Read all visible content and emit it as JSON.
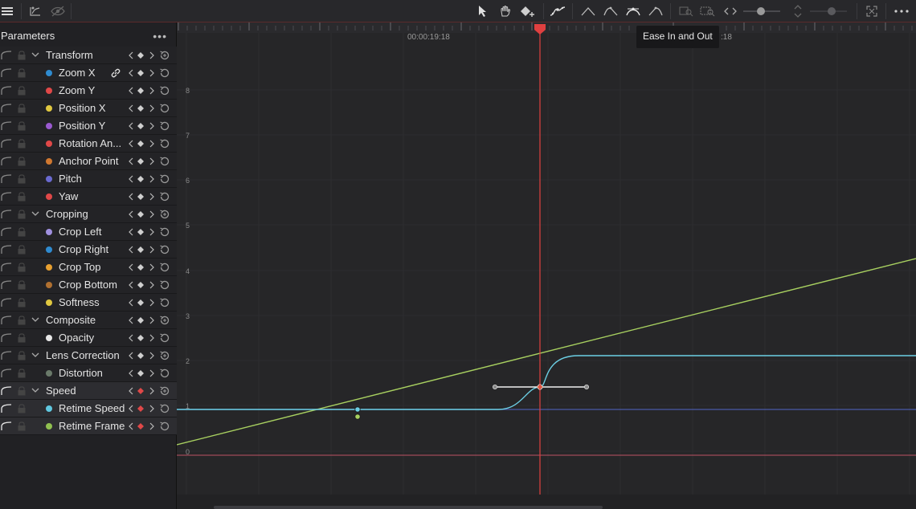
{
  "panel": {
    "title": "Parameters",
    "rows": [
      {
        "kind": "group",
        "label": "Transform",
        "keyframe": "none",
        "active": false
      },
      {
        "kind": "param",
        "label": "Zoom X",
        "dot": "#2f8bd0",
        "link": true,
        "keyframe": "none",
        "active": false
      },
      {
        "kind": "param",
        "label": "Zoom Y",
        "dot": "#e04848",
        "keyframe": "none",
        "active": false
      },
      {
        "kind": "param",
        "label": "Position X",
        "dot": "#e0c840",
        "keyframe": "none",
        "active": false
      },
      {
        "kind": "param",
        "label": "Position Y",
        "dot": "#9a5ad0",
        "keyframe": "none",
        "active": false
      },
      {
        "kind": "param",
        "label": "Rotation An...",
        "dot": "#e04848",
        "keyframe": "none",
        "active": false
      },
      {
        "kind": "param",
        "label": "Anchor Point",
        "dot": "#d07830",
        "keyframe": "none",
        "active": false
      },
      {
        "kind": "param",
        "label": "Pitch",
        "dot": "#6a6ad0",
        "keyframe": "none",
        "active": false
      },
      {
        "kind": "param",
        "label": "Yaw",
        "dot": "#e04848",
        "keyframe": "none",
        "active": false
      },
      {
        "kind": "group",
        "label": "Cropping",
        "keyframe": "none",
        "active": false
      },
      {
        "kind": "param",
        "label": "Crop Left",
        "dot": "#a090e0",
        "keyframe": "none",
        "active": false
      },
      {
        "kind": "param",
        "label": "Crop Right",
        "dot": "#2f8bd0",
        "keyframe": "none",
        "active": false
      },
      {
        "kind": "param",
        "label": "Crop Top",
        "dot": "#e8a030",
        "keyframe": "none",
        "active": false
      },
      {
        "kind": "param",
        "label": "Crop Bottom",
        "dot": "#b07030",
        "keyframe": "none",
        "active": false
      },
      {
        "kind": "param",
        "label": "Softness",
        "dot": "#e0c840",
        "keyframe": "none",
        "active": false
      },
      {
        "kind": "group",
        "label": "Composite",
        "keyframe": "none",
        "active": false
      },
      {
        "kind": "param",
        "label": "Opacity",
        "dot": "#e8e8e8",
        "keyframe": "none",
        "active": false
      },
      {
        "kind": "group",
        "label": "Lens Correction",
        "keyframe": "none",
        "active": false
      },
      {
        "kind": "param",
        "label": "Distortion",
        "dot": "#6a7a6a",
        "keyframe": "none",
        "active": false
      },
      {
        "kind": "group",
        "label": "Speed",
        "keyframe": "red",
        "active": true
      },
      {
        "kind": "param",
        "label": "Retime Speed",
        "dot": "#60c8e0",
        "keyframe": "red",
        "active": true
      },
      {
        "kind": "param",
        "label": "Retime Frame",
        "dot": "#90c050",
        "keyframe": "red",
        "active": true
      }
    ]
  },
  "toolbar": {
    "icons": [
      "menu-icon",
      "curve-select-icon",
      "hide-curves-icon",
      "pointer-icon",
      "hand-icon",
      "add-keyframe-icon",
      "curve-keyframe-icon",
      "linear-icon",
      "ease-in-icon",
      "ease-in-out-icon",
      "ease-out-icon",
      "zoom-fit-icon",
      "zoom-selection-icon",
      "horizontal-zoom-icon",
      "vertical-zoom-icon",
      "fullscreen-icon",
      "more-icon"
    ]
  },
  "graph": {
    "ruler": {
      "timecode_1": "00:00:19:18",
      "timecode_2_partial": ":18"
    },
    "y_ticks": [
      "8",
      "7",
      "6",
      "5",
      "4",
      "3",
      "2",
      "1",
      "0"
    ],
    "tooltip": "Ease In and Out",
    "colors": {
      "retime_speed": "#6ccfe4",
      "retime_frame": "#a8d060",
      "playhead": "#e04040",
      "baseline_speed": "#4a5aa8",
      "zero_line": "#b05060"
    }
  }
}
